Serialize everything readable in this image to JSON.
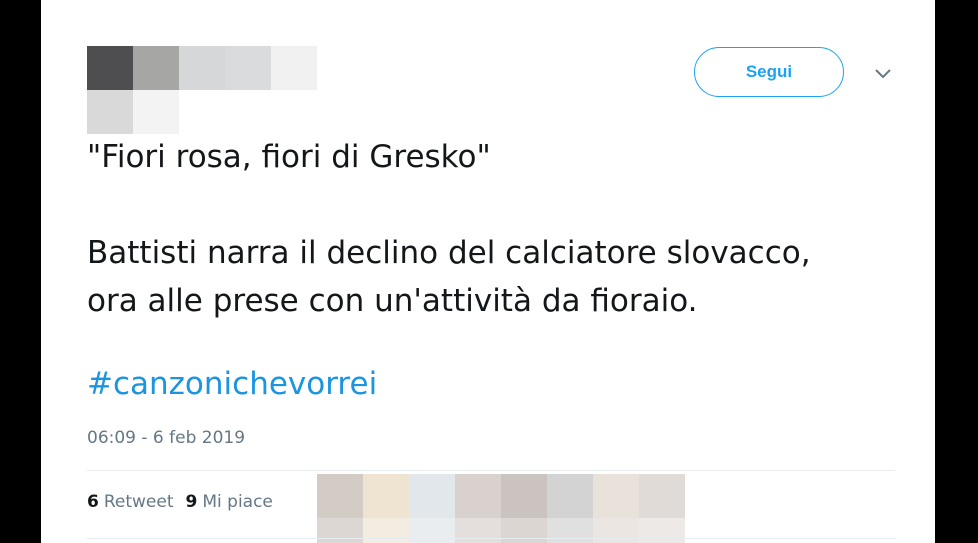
{
  "follow_button": {
    "label": "Segui"
  },
  "tweet": {
    "line1": "\"Fiori rosa, fiori di Gresko\"",
    "line2": "Battisti narra il declino del calciatore slovacco,",
    "line3": "ora alle prese con un'attività da fioraio.",
    "hashtag": "#canzonichevorrei",
    "timestamp": "06:09 - 6 feb 2019"
  },
  "stats": {
    "retweets_count": "6",
    "retweets_label": "Retweet",
    "likes_count": "9",
    "likes_label": "Mi piace"
  },
  "colors": {
    "accent": "#1da1f2",
    "hashtag": "#1b95e0",
    "text": "#14171a",
    "muted": "#657786"
  },
  "icons": {
    "menu": "chevron-down-icon"
  }
}
